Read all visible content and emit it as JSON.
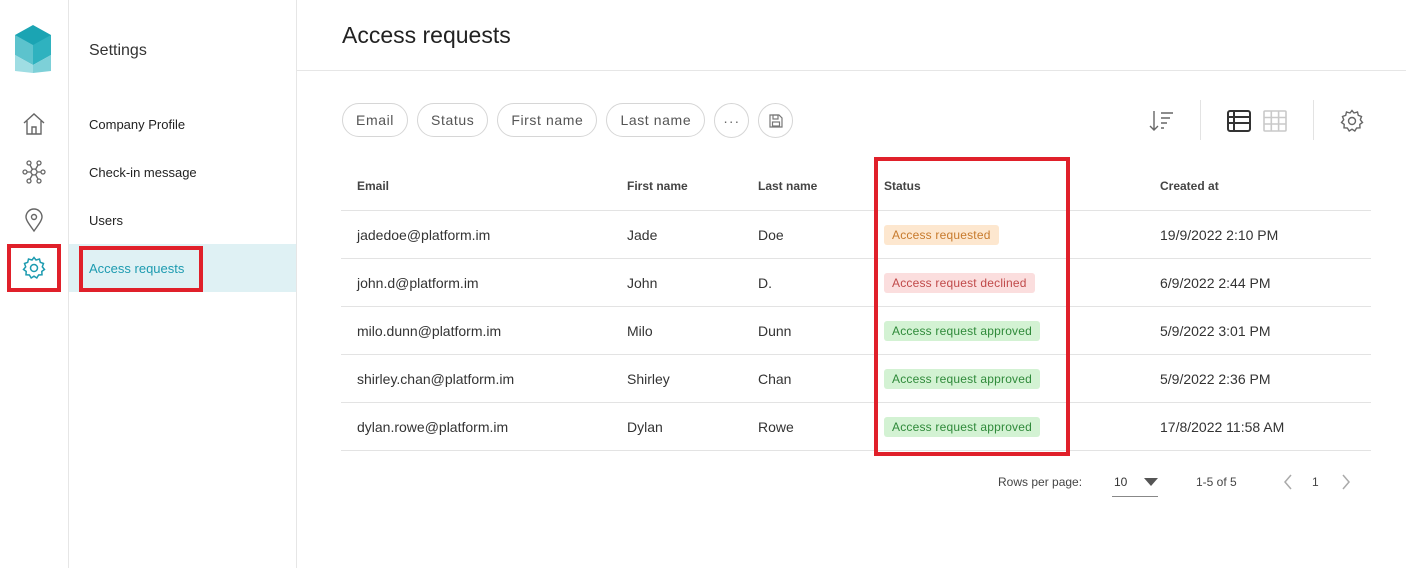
{
  "settings": {
    "title": "Settings",
    "menu": [
      {
        "label": "Company Profile"
      },
      {
        "label": "Check-in message"
      },
      {
        "label": "Users"
      },
      {
        "label": "Access requests"
      }
    ]
  },
  "rail": {
    "items": [
      "home-icon",
      "network-icon",
      "location-pin-icon",
      "gear-icon"
    ],
    "active": "gear-icon"
  },
  "page": {
    "title": "Access requests"
  },
  "filters": {
    "chips": [
      "Email",
      "Status",
      "First name",
      "Last name"
    ],
    "more_label": "···"
  },
  "table": {
    "columns": {
      "email": "Email",
      "first_name": "First name",
      "last_name": "Last name",
      "status": "Status",
      "created_at": "Created at"
    },
    "rows": [
      {
        "email": "jadedoe@platform.im",
        "first_name": "Jade",
        "last_name": "Doe",
        "status": "Access requested",
        "status_kind": "requested",
        "created_at": "19/9/2022 2:10 PM"
      },
      {
        "email": "john.d@platform.im",
        "first_name": "John",
        "last_name": "D.",
        "status": "Access request declined",
        "status_kind": "declined",
        "created_at": "6/9/2022 2:44 PM"
      },
      {
        "email": "milo.dunn@platform.im",
        "first_name": "Milo",
        "last_name": "Dunn",
        "status": "Access request approved",
        "status_kind": "approved",
        "created_at": "5/9/2022 3:01 PM"
      },
      {
        "email": "shirley.chan@platform.im",
        "first_name": "Shirley",
        "last_name": "Chan",
        "status": "Access request approved",
        "status_kind": "approved",
        "created_at": "5/9/2022 2:36 PM"
      },
      {
        "email": "dylan.rowe@platform.im",
        "first_name": "Dylan",
        "last_name": "Rowe",
        "status": "Access request approved",
        "status_kind": "approved",
        "created_at": "17/8/2022 11:58 AM"
      }
    ]
  },
  "pagination": {
    "rows_per_page_label": "Rows per page:",
    "rows_per_page": "10",
    "range": "1-5 of 5",
    "page": "1"
  },
  "colors": {
    "accent": "#1d9bb0",
    "highlight": "#e0202a",
    "requested_bg": "#fde7cf",
    "declined_bg": "#fbdede",
    "approved_bg": "#d3f2d3"
  }
}
